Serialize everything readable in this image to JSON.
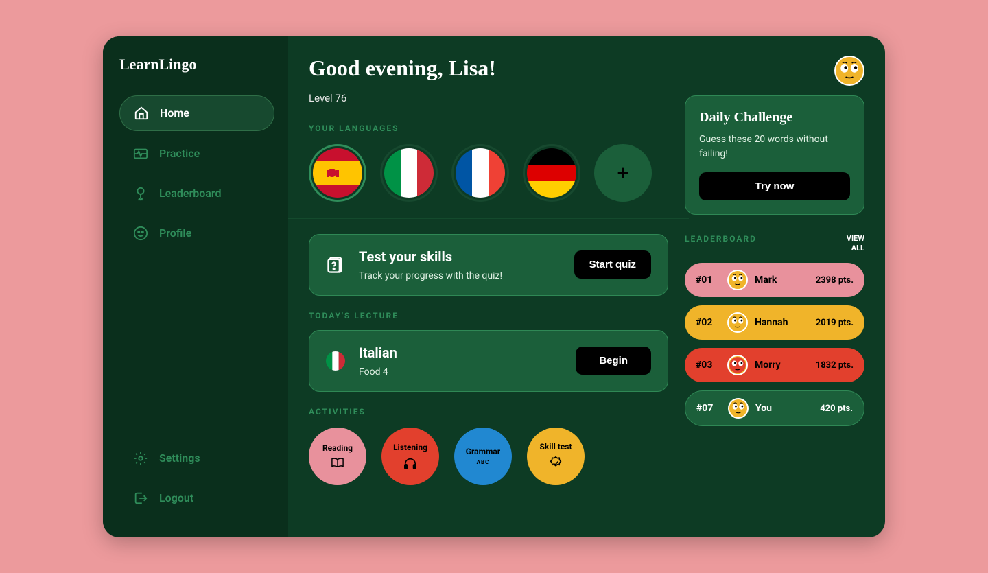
{
  "app_name": "LearnLingo",
  "sidebar": {
    "home": "Home",
    "practice": "Practice",
    "leaderboard": "Leaderboard",
    "profile": "Profile",
    "settings": "Settings",
    "logout": "Logout"
  },
  "header": {
    "greeting": "Good evening, Lisa!",
    "level": "Level 76"
  },
  "languages": {
    "label": "YOUR LANGUAGES",
    "items": [
      "spain",
      "italy",
      "france",
      "germany"
    ]
  },
  "test_card": {
    "title": "Test your skills",
    "subtitle": "Track your progress with the quiz!",
    "button": "Start quiz"
  },
  "lecture": {
    "label": "TODAY'S LECTURE",
    "language": "Italian",
    "lesson": "Food 4",
    "button": "Begin"
  },
  "activities": {
    "label": "ACTIVITIES",
    "reading": "Reading",
    "listening": "Listening",
    "grammar": "Grammar",
    "grammar_sub": "ABC",
    "skilltest": "Skill test"
  },
  "daily": {
    "title": "Daily Challenge",
    "desc": "Guess these 20 words without failing!",
    "button": "Try now"
  },
  "leaderboard": {
    "label": "LEADERBOARD",
    "view_all": "VIEW ALL",
    "rows": [
      {
        "rank": "#01",
        "name": "Mark",
        "pts": "2398 pts."
      },
      {
        "rank": "#02",
        "name": "Hannah",
        "pts": "2019 pts."
      },
      {
        "rank": "#03",
        "name": "Morry",
        "pts": "1832 pts."
      },
      {
        "rank": "#07",
        "name": "You",
        "pts": "420 pts."
      }
    ]
  }
}
